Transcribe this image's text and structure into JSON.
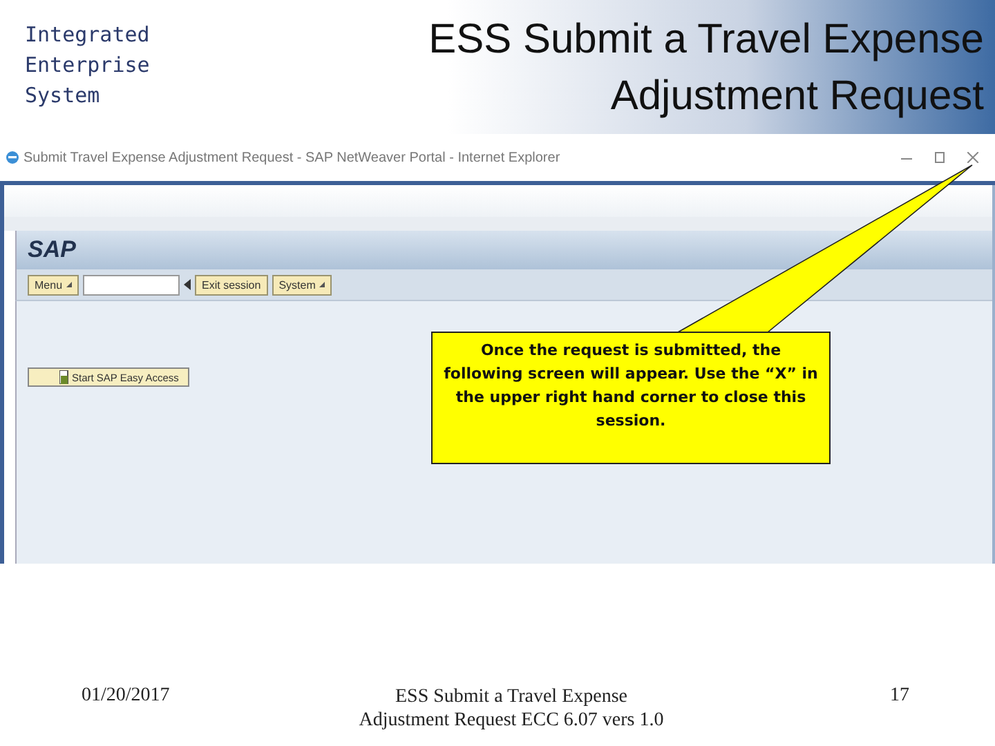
{
  "slide_header": {
    "org_lines": [
      "Integrated",
      "Enterprise",
      "System"
    ],
    "title_lines": [
      "ESS Submit a Travel Expense",
      "Adjustment Request"
    ]
  },
  "browser_window": {
    "title": "Submit Travel Expense Adjustment Request - SAP NetWeaver Portal - Internet Explorer"
  },
  "sap": {
    "logo": "SAP",
    "toolbar": [
      {
        "kind": "menu",
        "label": "Menu"
      },
      {
        "kind": "field"
      },
      {
        "kind": "back"
      },
      {
        "kind": "button",
        "label": "Exit session"
      },
      {
        "kind": "menu",
        "label": "System"
      }
    ],
    "start_button": "Start SAP Easy Access"
  },
  "callout": {
    "text": "Once the request is submitted, the following screen will appear.  Use the “X” in the upper right hand corner to close this session."
  },
  "footer": {
    "date": "01/20/2017",
    "caption_lines": [
      "ESS Submit a Travel Expense",
      "Adjustment Request ECC 6.07 vers 1.0"
    ],
    "page": "17"
  }
}
